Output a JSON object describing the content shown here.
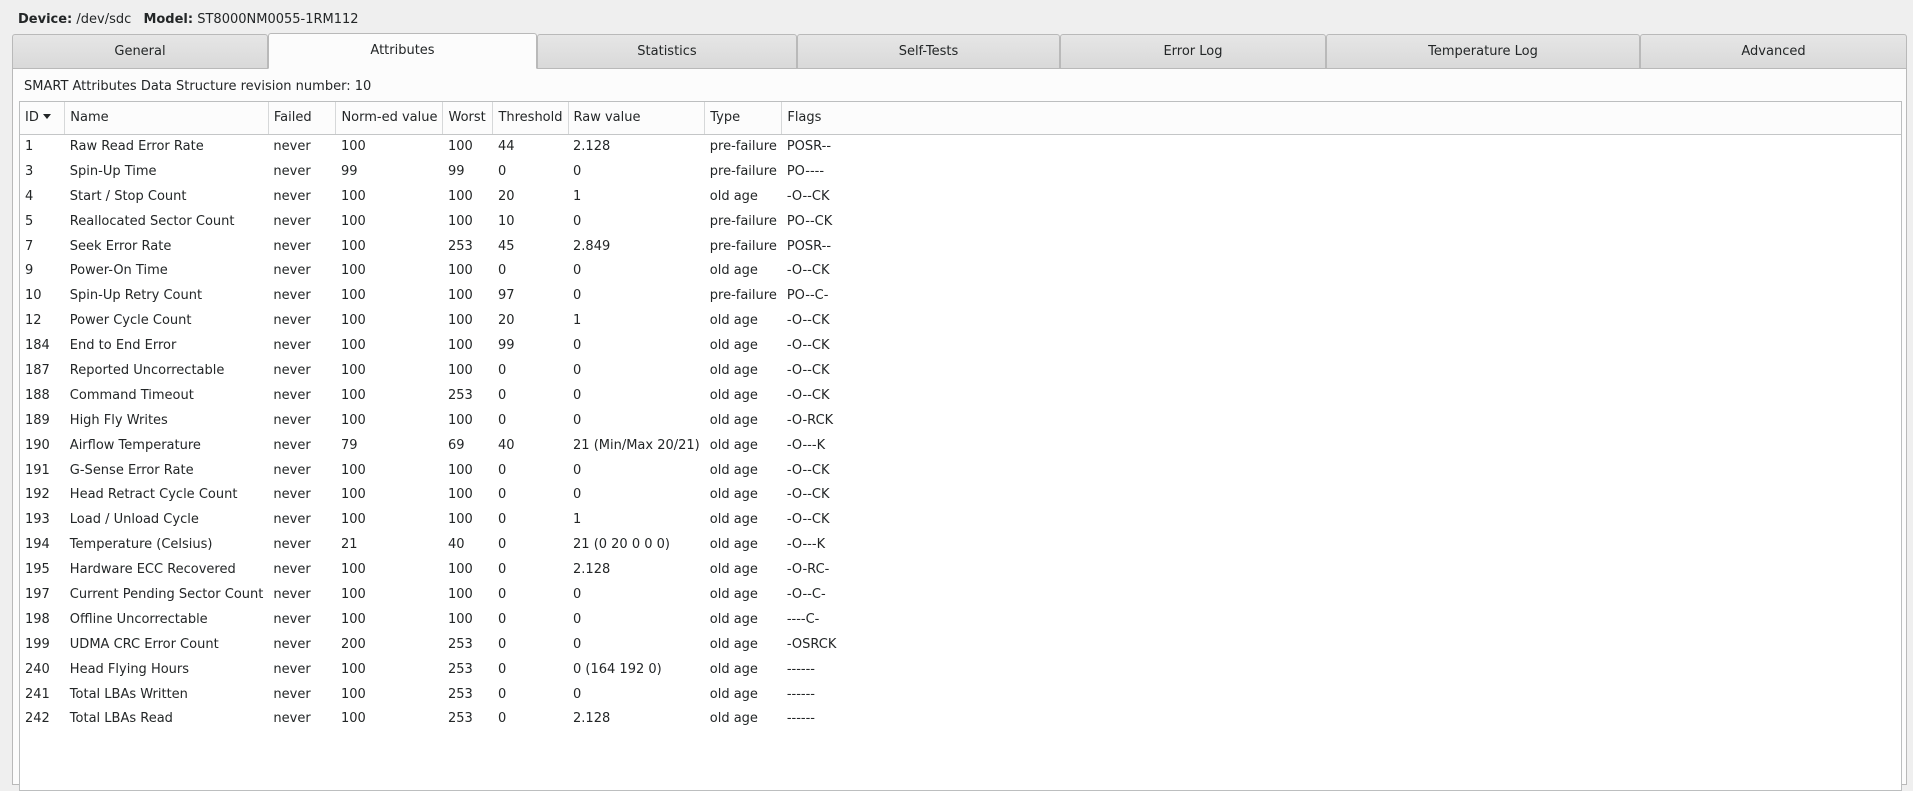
{
  "device": {
    "device_label": "Device:",
    "device_value": "/dev/sdc",
    "model_label": "Model:",
    "model_value": "ST8000NM0055-1RM112"
  },
  "tabs": [
    {
      "label": "General",
      "active": false
    },
    {
      "label": "Attributes",
      "active": true
    },
    {
      "label": "Statistics",
      "active": false
    },
    {
      "label": "Self-Tests",
      "active": false
    },
    {
      "label": "Error Log",
      "active": false
    },
    {
      "label": "Temperature Log",
      "active": false
    },
    {
      "label": "Advanced",
      "active": false
    }
  ],
  "revision_text": "SMART Attributes Data Structure revision number: 10",
  "columns": [
    "ID",
    "Name",
    "Failed",
    "Norm-ed value",
    "Worst",
    "Threshold",
    "Raw value",
    "Type",
    "Flags"
  ],
  "sort": {
    "column": "ID",
    "direction": "descending-arrow"
  },
  "rows": [
    [
      "1",
      "Raw Read Error Rate",
      "never",
      "100",
      "100",
      "44",
      "2.128",
      "pre-failure",
      "POSR--"
    ],
    [
      "3",
      "Spin-Up Time",
      "never",
      "99",
      "99",
      "0",
      "0",
      "pre-failure",
      "PO----"
    ],
    [
      "4",
      "Start / Stop Count",
      "never",
      "100",
      "100",
      "20",
      "1",
      "old age",
      "-O--CK"
    ],
    [
      "5",
      "Reallocated Sector Count",
      "never",
      "100",
      "100",
      "10",
      "0",
      "pre-failure",
      "PO--CK"
    ],
    [
      "7",
      "Seek Error Rate",
      "never",
      "100",
      "253",
      "45",
      "2.849",
      "pre-failure",
      "POSR--"
    ],
    [
      "9",
      "Power-On Time",
      "never",
      "100",
      "100",
      "0",
      "0",
      "old age",
      "-O--CK"
    ],
    [
      "10",
      "Spin-Up Retry Count",
      "never",
      "100",
      "100",
      "97",
      "0",
      "pre-failure",
      "PO--C-"
    ],
    [
      "12",
      "Power Cycle Count",
      "never",
      "100",
      "100",
      "20",
      "1",
      "old age",
      "-O--CK"
    ],
    [
      "184",
      "End to End Error",
      "never",
      "100",
      "100",
      "99",
      "0",
      "old age",
      "-O--CK"
    ],
    [
      "187",
      "Reported Uncorrectable",
      "never",
      "100",
      "100",
      "0",
      "0",
      "old age",
      "-O--CK"
    ],
    [
      "188",
      "Command Timeout",
      "never",
      "100",
      "253",
      "0",
      "0",
      "old age",
      "-O--CK"
    ],
    [
      "189",
      "High Fly Writes",
      "never",
      "100",
      "100",
      "0",
      "0",
      "old age",
      "-O-RCK"
    ],
    [
      "190",
      "Airflow Temperature",
      "never",
      "79",
      "69",
      "40",
      "21 (Min/Max 20/21)",
      "old age",
      "-O---K"
    ],
    [
      "191",
      "G-Sense Error Rate",
      "never",
      "100",
      "100",
      "0",
      "0",
      "old age",
      "-O--CK"
    ],
    [
      "192",
      "Head Retract Cycle Count",
      "never",
      "100",
      "100",
      "0",
      "0",
      "old age",
      "-O--CK"
    ],
    [
      "193",
      "Load / Unload Cycle",
      "never",
      "100",
      "100",
      "0",
      "1",
      "old age",
      "-O--CK"
    ],
    [
      "194",
      "Temperature (Celsius)",
      "never",
      "21",
      "40",
      "0",
      "21 (0 20 0 0 0)",
      "old age",
      "-O---K"
    ],
    [
      "195",
      "Hardware ECC Recovered",
      "never",
      "100",
      "100",
      "0",
      "2.128",
      "old age",
      "-O-RC-"
    ],
    [
      "197",
      "Current Pending Sector Count",
      "never",
      "100",
      "100",
      "0",
      "0",
      "old age",
      "-O--C-"
    ],
    [
      "198",
      "Offline Uncorrectable",
      "never",
      "100",
      "100",
      "0",
      "0",
      "old age",
      "----C-"
    ],
    [
      "199",
      "UDMA CRC Error Count",
      "never",
      "200",
      "253",
      "0",
      "0",
      "old age",
      "-OSRCK"
    ],
    [
      "240",
      "Head Flying Hours",
      "never",
      "100",
      "253",
      "0",
      "0 (164 192 0)",
      "old age",
      "------"
    ],
    [
      "241",
      "Total LBAs Written",
      "never",
      "100",
      "253",
      "0",
      "0",
      "old age",
      "------"
    ],
    [
      "242",
      "Total LBAs Read",
      "never",
      "100",
      "253",
      "0",
      "2.128",
      "old age",
      "------"
    ]
  ]
}
